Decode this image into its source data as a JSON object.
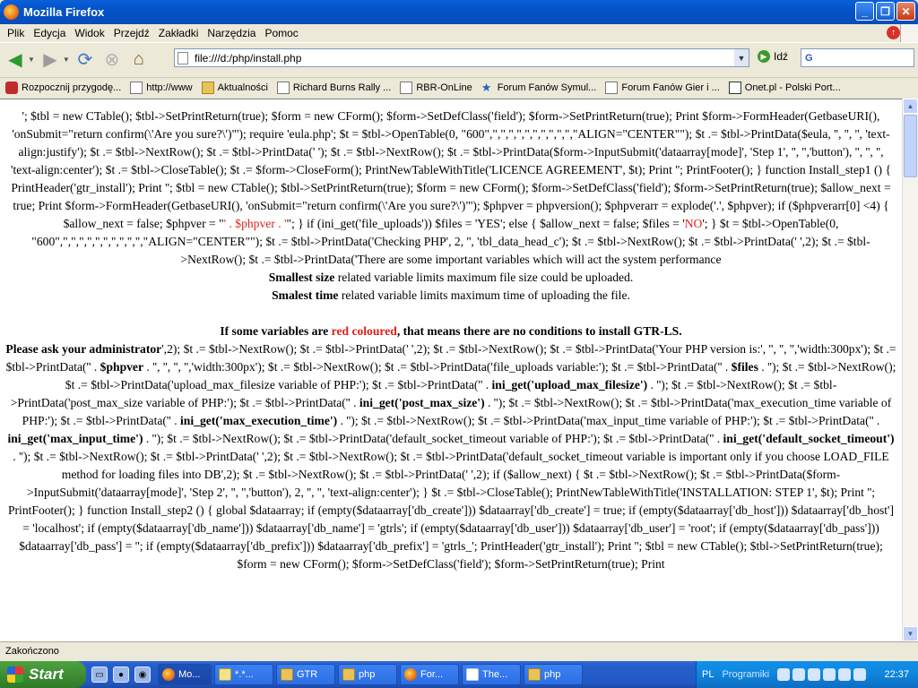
{
  "window": {
    "title": "Mozilla Firefox"
  },
  "menu": [
    "Plik",
    "Edycja",
    "Widok",
    "Przejdź",
    "Zakładki",
    "Narzędzia",
    "Pomoc"
  ],
  "nav": {
    "url": "file:///d:/php/install.php",
    "go_label": "Idź",
    "search_value": "G"
  },
  "bookmarks": [
    {
      "label": "Rozpocznij przygodę...",
      "icon": "red"
    },
    {
      "label": "http://www",
      "icon": "page"
    },
    {
      "label": "Aktualności",
      "icon": "folder"
    },
    {
      "label": "Richard Burns Rally ...",
      "icon": "page"
    },
    {
      "label": "RBR-OnLine",
      "icon": "page"
    },
    {
      "label": "Forum Fanów Symul...",
      "icon": "star"
    },
    {
      "label": "Forum Fanów Gier i ...",
      "icon": "page"
    },
    {
      "label": "Onet.pl - Polski Port...",
      "icon": "onet"
    }
  ],
  "content": {
    "l1": "'; $tbl = new CTable(); $tbl->SetPrintReturn(true); $form = new CForm(); $form->SetDefClass('field'); $form->SetPrintReturn(true); Print $form->FormHeader(GetbaseURI(), 'onSubmit=\"return confirm(\\'Are you sure?\\')\"'); require 'eula.php'; $t = $tbl->OpenTable(0, \"600\",\",\",\",\",\",\",\",\",\",\",\"ALIGN=\"CENTER\"\"); $t .= $tbl->PrintData($eula, '', '', '', 'text-align:justify'); $t .= $tbl->NextRow(); $t .= $tbl->PrintData(' '); $t .= $tbl->NextRow(); $t .= $tbl->PrintData($form->InputSubmit('dataarray[mode]', 'Step 1', '', '','button'), '', '', '', 'text-align:center'); $t .= $tbl->CloseTable(); $t .= $form->CloseForm(); PrintNewTableWithTitle('LICENCE AGREEMENT', $t); Print ''; PrintFooter(); } function Install_step1 () { PrintHeader('gtr_install'); Print '",
    "l2a": "'; $tbl = new CTable(); $tbl->SetPrintReturn(true); $form = new CForm(); $form->SetDefClass('field'); $form->SetPrintReturn(true); $allow_next = true; Print $form->FormHeader(GetbaseURI(), 'onSubmit=\"return confirm(\\'Are you sure?\\')\"'); $phpver = phpversion(); $phpverarr = explode('.', $phpver); if ($phpverarr[0] <4) { $allow_next = false; $phpver = \"",
    "l2red1": "' . $phpver . '",
    "l2b": "\"; } if (ini_get('file_uploads')) $files = 'YES'; else { $allow_next = false; $files = '",
    "l2red2": "NO",
    "l2c": "'; } $t = $tbl->OpenTable(0, \"600\",\",\",\",\",\",\",\",\",\",\",\"ALIGN=\"CENTER\"\"); $t .= $tbl->PrintData('Checking PHP', 2, '', 'tbl_data_head_c'); $t .= $tbl->NextRow(); $t .= $tbl->PrintData(' ',2); $t .= $tbl->NextRow(); $t .= $tbl->PrintData('There are some important variables which will act the system performance",
    "l3b": "Smallest size",
    "l3": " related variable limits maximum file size could be uploaded.",
    "l4b": "Smalest time",
    "l4": " related variable limits maximum time of uploading the file.",
    "l5a": "If some variables are ",
    "l5red": "red coloured",
    "l5b": ", that means there are no conditions to install GTR-LS.",
    "l6b": "Please ask your administrator",
    "l6": "',2); $t .= $tbl->NextRow(); $t .= $tbl->PrintData(' ',2); $t .= $tbl->NextRow(); $t .= $tbl->PrintData('Your PHP version is:', '', '', '','width:300px'); $t .= $tbl->PrintData('' . ",
    "l6b2": "$phpver",
    "l6c": " . '', '', '', '','width:300px'); $t .= $tbl->NextRow(); $t .= $tbl->PrintData('file_uploads variable:'); $t .= $tbl->PrintData('' . ",
    "l6b3": "$files",
    "l6d": " . ''); $t .= $tbl->NextRow(); $t .= $tbl->PrintData('upload_max_filesize variable of PHP:'); $t .= $tbl->PrintData('' . ",
    "l7b": "ini_get('upload_max_filesize')",
    "l7": " . ''); $t .= $tbl->NextRow(); $t .= $tbl->PrintData('post_max_size variable of PHP:'); $t .= $tbl->PrintData('' . ",
    "l8b": "ini_get('post_max_size')",
    "l8": " . ''); $t .= $tbl->NextRow(); $t .= $tbl->PrintData('max_execution_time variable of PHP:'); $t .= $tbl->PrintData('' . ",
    "l9b": "ini_get('max_execution_time')",
    "l9": " . ''); $t .= $tbl->NextRow(); $t .= $tbl->PrintData('max_input_time variable of PHP:'); $t .= $tbl->PrintData('' . ",
    "l10b": "ini_get('max_input_time')",
    "l10": " . ''); $t .= $tbl->NextRow(); $t .= $tbl->PrintData('default_socket_timeout variable of PHP:'); $t .= $tbl->PrintData('' . ",
    "l11b": "ini_get('default_socket_timeout')",
    "l11": " . ''); $t .= $tbl->NextRow(); $t .= $tbl->PrintData(' ',2); $t .= $tbl->NextRow(); $t .= $tbl->PrintData('default_socket_timeout variable is important only if you choose LOAD_FILE method for loading files into DB',2); $t .= $tbl->NextRow(); $t .= $tbl->PrintData(' ',2); if ($allow_next) { $t .= $tbl->NextRow(); $t .= $tbl->PrintData($form->InputSubmit('dataarray[mode]', 'Step 2', '', '','button'), 2, '', '', 'text-align:center'); } $t .= $tbl->CloseTable(); PrintNewTableWithTitle('INSTALLATION: STEP 1', $t); Print '",
    "l12": "'; PrintFooter(); } function Install_step2 () { global $dataarray; if (empty($dataarray['db_create'])) $dataarray['db_create'] = true; if (empty($dataarray['db_host'])) $dataarray['db_host'] = 'localhost'; if (empty($dataarray['db_name'])) $dataarray['db_name'] = 'gtrls'; if (empty($dataarray['db_user'])) $dataarray['db_user'] = 'root'; if (empty($dataarray['db_pass'])) $dataarray['db_pass'] = ''; if (empty($dataarray['db_prefix'])) $dataarray['db_prefix'] = 'gtrls_'; PrintHeader('gtr_install'); Print '",
    "l13": "'; $tbl = new CTable(); $tbl->SetPrintReturn(true); $form = new CForm(); $form->SetDefClass('field'); $form->SetPrintReturn(true); Print"
  },
  "status": "Zakończono",
  "taskbar": {
    "start": "Start",
    "tasks": [
      {
        "label": "Mo...",
        "icon": "ff",
        "active": true
      },
      {
        "label": "*.*...",
        "icon": "mail"
      },
      {
        "label": "GTR",
        "icon": "folder"
      },
      {
        "label": "php",
        "icon": "folder"
      },
      {
        "label": "For...",
        "icon": "ff"
      },
      {
        "label": "The...",
        "icon": "win"
      },
      {
        "label": "php",
        "icon": "folder"
      }
    ],
    "lang": "PL",
    "programs": "Programiki",
    "clock": "22:37"
  }
}
